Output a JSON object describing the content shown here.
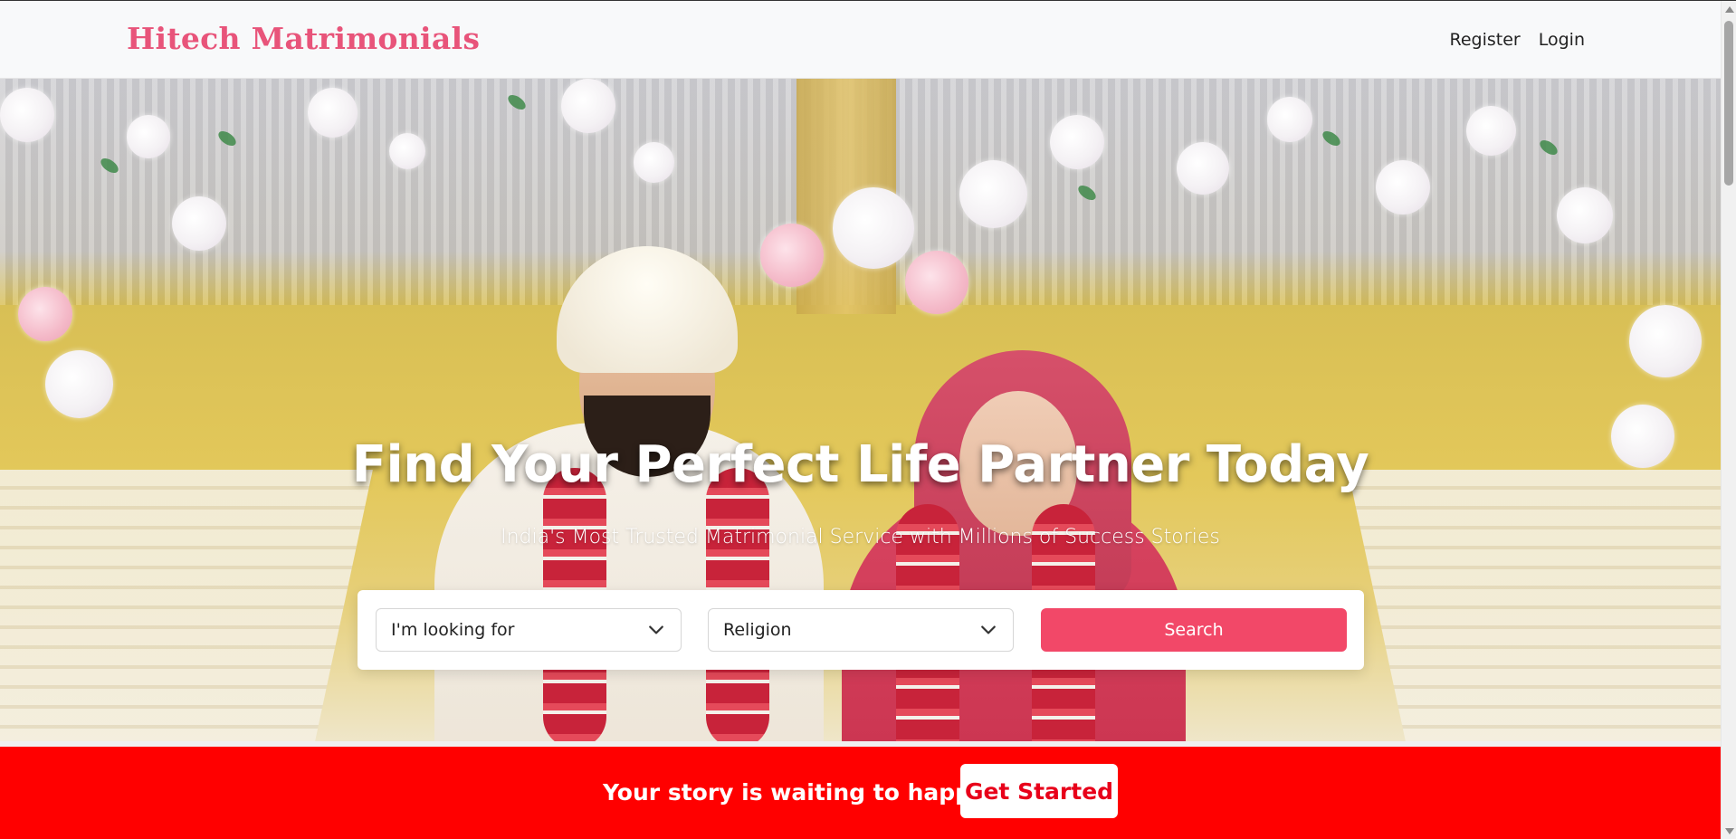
{
  "brand": {
    "name": "Hitech Matrimonials"
  },
  "nav": {
    "register": "Register",
    "login": "Login"
  },
  "hero": {
    "title": "Find Your Perfect Life Partner Today",
    "subtitle": "India's Most Trusted Matrimonial Service with Millions of Success Stories"
  },
  "search": {
    "looking_for": "I'm looking for",
    "religion": "Religion",
    "button": "Search"
  },
  "cta": {
    "text": "Your story is waiting to happen!",
    "button": "Get Started"
  },
  "colors": {
    "brand": "#e8547a",
    "search_button": "#f24868",
    "cta_bar": "#ff0000"
  }
}
